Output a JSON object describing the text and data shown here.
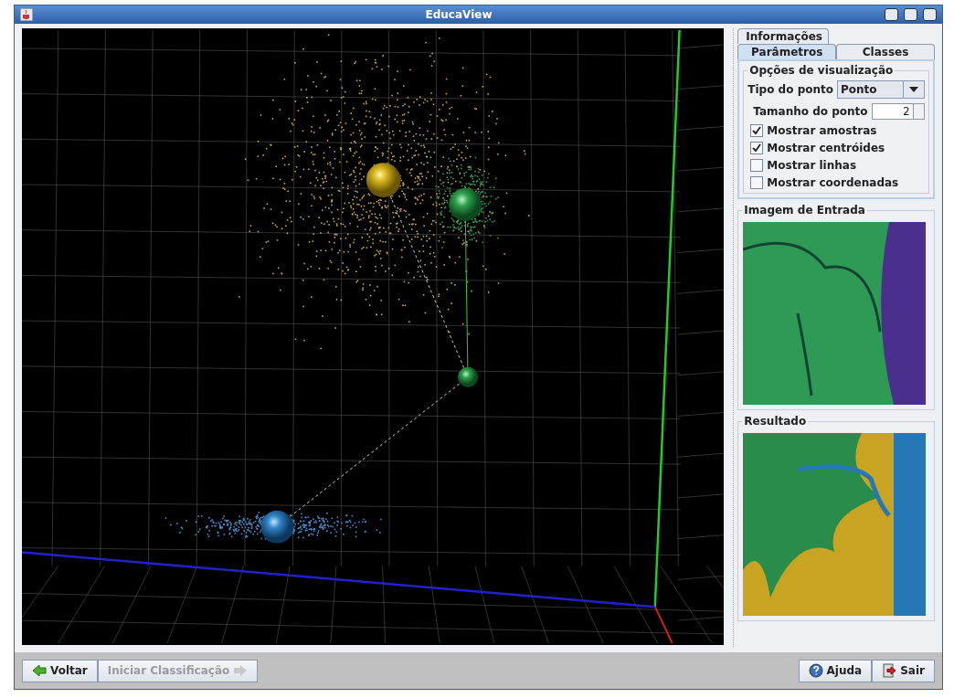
{
  "window": {
    "title": "EducaView"
  },
  "tab_rows": [
    [
      {
        "label": "Informações",
        "selected": false
      }
    ],
    [
      {
        "label": "Parâmetros",
        "selected": true
      },
      {
        "label": "Classes",
        "selected": false
      }
    ]
  ],
  "options": {
    "title": "Opções de visualização",
    "point_type": {
      "label": "Tipo do ponto",
      "value": "Ponto"
    },
    "point_size": {
      "label": "Tamanho do ponto",
      "value": "2"
    },
    "checkboxes": [
      {
        "label": "Mostrar amostras",
        "checked": true
      },
      {
        "label": "Mostrar centróides",
        "checked": true
      },
      {
        "label": "Mostrar linhas",
        "checked": false
      },
      {
        "label": "Mostrar coordenadas",
        "checked": false
      }
    ]
  },
  "input_image": {
    "title": "Imagem de Entrada"
  },
  "result": {
    "title": "Resultado"
  },
  "buttons_left": [
    {
      "label": "Voltar",
      "kind": "back",
      "disabled": false
    },
    {
      "label": "Iniciar Classificação",
      "kind": "forward",
      "disabled": true
    }
  ],
  "buttons_right": [
    {
      "label": "Ajuda",
      "kind": "help",
      "disabled": false
    },
    {
      "label": "Sair",
      "kind": "exit",
      "disabled": false
    }
  ]
}
